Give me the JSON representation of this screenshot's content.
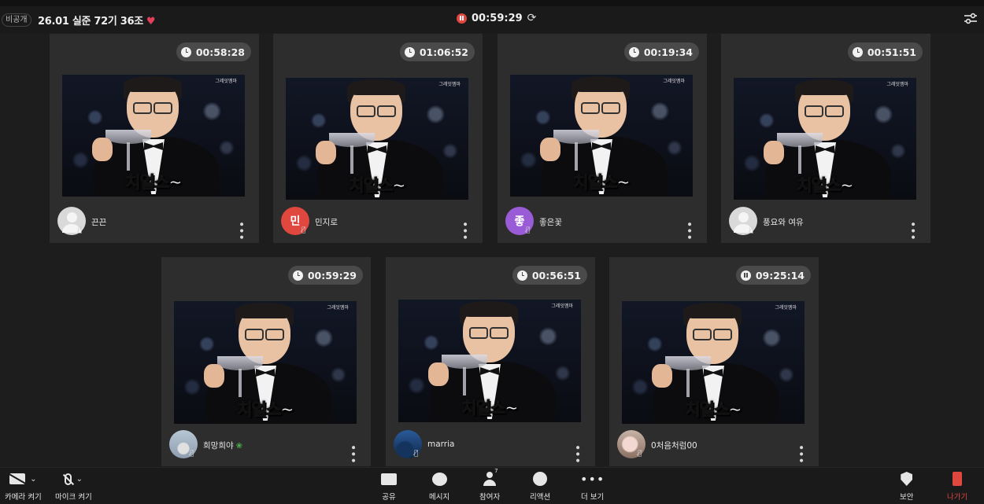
{
  "header": {
    "privacy_label": "비공개",
    "meeting_title": "26.01 실준 72기 36조",
    "heart": "♥",
    "recording_time": "00:59:29",
    "refresh_glyph": "⟳"
  },
  "video_content": {
    "watermark": "그레잇멤마",
    "caption": "치얼스~"
  },
  "participants": [
    {
      "name": "끈끈",
      "timer": "00:58:28",
      "timer_state": "clock",
      "avatar": "gray",
      "initial": ""
    },
    {
      "name": "민지로",
      "timer": "01:06:52",
      "timer_state": "clock",
      "avatar": "letter",
      "initial": "민",
      "avatar_color": "#e0473e"
    },
    {
      "name": "좋은꽃",
      "timer": "00:19:34",
      "timer_state": "clock",
      "avatar": "letter",
      "initial": "좋",
      "avatar_color": "#9a5bd6"
    },
    {
      "name": "풍요와 여유",
      "timer": "00:51:51",
      "timer_state": "clock",
      "avatar": "gray",
      "initial": ""
    },
    {
      "name": "희망희야",
      "timer": "00:59:29",
      "timer_state": "clock",
      "avatar": "photo-sky",
      "initial": "",
      "name_suffix": "❀"
    },
    {
      "name": "marria",
      "timer": "00:56:51",
      "timer_state": "clock",
      "avatar": "photo-night",
      "initial": ""
    },
    {
      "name": "0처음처럼00",
      "timer": "09:25:14",
      "timer_state": "pause",
      "avatar": "photo-flower",
      "initial": ""
    }
  ],
  "toolbar": {
    "camera_label": "카메라 켜기",
    "mic_label": "마이크 켜기",
    "share_label": "공유",
    "chat_label": "메시지",
    "participants_label": "참여자",
    "participants_count": "7",
    "reaction_label": "리액션",
    "more_label": "더 보기",
    "security_label": "보안",
    "leave_label": "나가기",
    "chevron": "⌄",
    "more_glyph": "•••"
  },
  "colors": {
    "accent_red": "#e0473e",
    "heart": "#e0405a",
    "tile_bg": "#2d2d2d"
  }
}
